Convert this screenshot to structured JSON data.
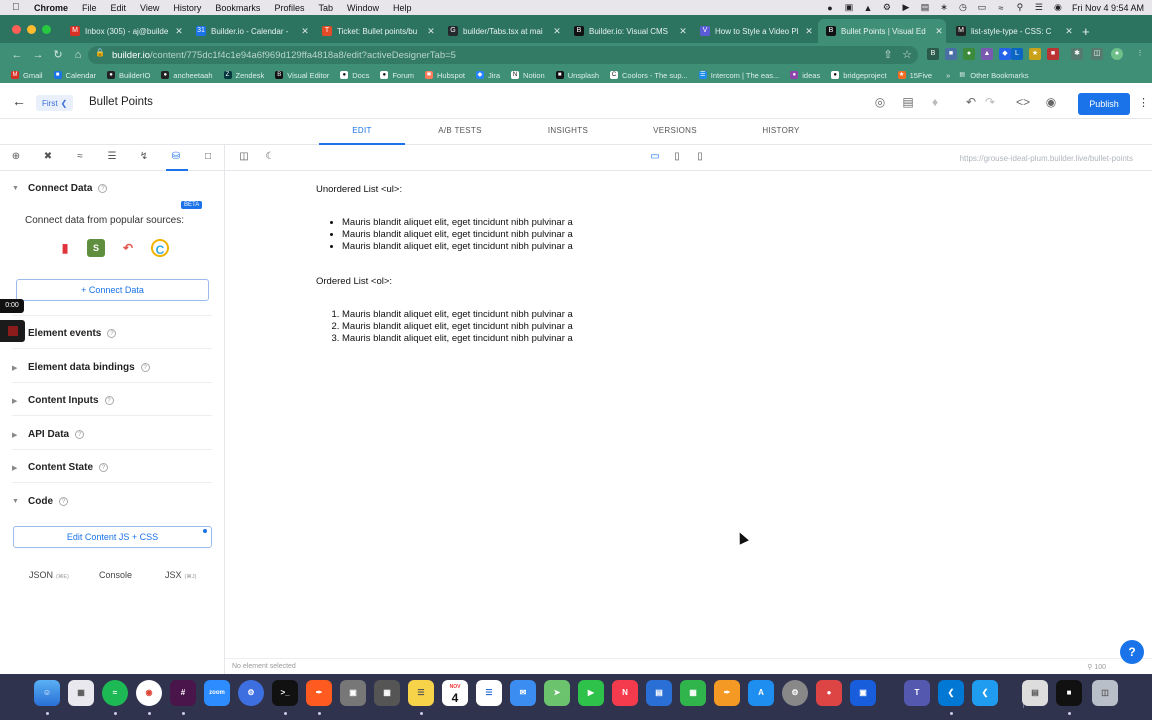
{
  "menubar": {
    "app": "Chrome",
    "items": [
      "File",
      "Edit",
      "View",
      "History",
      "Bookmarks",
      "Profiles",
      "Tab",
      "Window",
      "Help"
    ],
    "clock": "Fri Nov 4  9:54 AM"
  },
  "browser": {
    "tabs": [
      {
        "title": "Inbox (305) - aj@builde",
        "color": "#d93025",
        "glyph": "M"
      },
      {
        "title": "Builder.io - Calendar -",
        "color": "#1a73e8",
        "glyph": "31"
      },
      {
        "title": "Ticket: Bullet points/bu",
        "color": "#e34c26",
        "glyph": "T"
      },
      {
        "title": "builder/Tabs.tsx at mai",
        "color": "#24292e",
        "glyph": "G"
      },
      {
        "title": "Builder.io: Visual CMS",
        "color": "#111111",
        "glyph": "B"
      },
      {
        "title": "How to Style a Video Pl",
        "color": "#5b5bd6",
        "glyph": "V"
      },
      {
        "title": "Bullet Points | Visual Ed",
        "color": "#111111",
        "glyph": "B"
      },
      {
        "title": "list-style-type - CSS: C",
        "color": "#222222",
        "glyph": "M"
      }
    ],
    "url_host": "builder.io",
    "url_path": "/content/775dc1f4c1e94a6f969d129ffa4818a8/edit?activeDesignerTab=5",
    "bookmarks": [
      "Gmail",
      "Calendar",
      "BuilderIO",
      "ancheetaah",
      "Zendesk",
      "Visual Editor",
      "Docs",
      "Forum",
      "Hubspot",
      "Jira",
      "Notion",
      "Unsplash",
      "Coolors - The sup...",
      "Intercom | The eas...",
      "ideas",
      "bridgeproject",
      "15Five"
    ],
    "other_bookmarks": "Other Bookmarks"
  },
  "editor": {
    "back_icon": "back-arrow-icon",
    "pill_label": "First",
    "title": "Bullet Points",
    "publish_label": "Publish",
    "tabs": [
      "EDIT",
      "A/B TESTS",
      "INSIGHTS",
      "VERSIONS",
      "HISTORY"
    ],
    "active_tab": "EDIT",
    "preview_url": "https://grouse-ideal-plum.builder.live/bullet-points",
    "status_left": "No element selected",
    "zoom": "100",
    "help_glyph": "?"
  },
  "panel": {
    "connect_title": "Connect Data",
    "beta": "BETA",
    "connect_sub": "Connect data from popular sources:",
    "connect_button": "+ Connect Data",
    "sections": [
      "Element events",
      "Element data bindings",
      "Content Inputs",
      "API Data",
      "Content State"
    ],
    "code_title": "Code",
    "edit_js_button": "Edit Content JS + CSS",
    "code_tabs": [
      {
        "label": "JSON",
        "kbd": "(⌘E)"
      },
      {
        "label": "Console",
        "kbd": ""
      },
      {
        "label": "JSX",
        "kbd": "(⌘J)"
      }
    ],
    "timer": "0:00"
  },
  "content": {
    "ul_heading": "Unordered List <ul>:",
    "ul_items": [
      "Mauris blandit aliquet elit, eget tincidunt nibh pulvinar a",
      "Mauris blandit aliquet elit, eget tincidunt nibh pulvinar a",
      "Mauris blandit aliquet elit, eget tincidunt nibh pulvinar a"
    ],
    "ol_heading": "Ordered List <ol>:",
    "ol_items": [
      "Mauris blandit aliquet elit, eget tincidunt nibh pulvinar a",
      "Mauris blandit aliquet elit, eget tincidunt nibh pulvinar a",
      "Mauris blandit aliquet elit, eget tincidunt nibh pulvinar a"
    ]
  },
  "dock": {
    "apps": [
      "finder",
      "launchpad",
      "spotify",
      "chrome",
      "slack",
      "zoom",
      "settings-gear",
      "terminal",
      "pen-tool",
      "screenshot",
      "calculator",
      "notes",
      "calendar",
      "reminders",
      "mail",
      "maps",
      "facetime",
      "news",
      "keynote",
      "numbers",
      "pages",
      "app-store",
      "system-preferences",
      "screen-recorder",
      "bitwarden",
      "teams",
      "vscode",
      "vscode-insiders",
      "preview",
      "terminal-window",
      "trash"
    ],
    "calendar_month": "NOV",
    "calendar_day": "4"
  },
  "colors": {
    "accent": "#1a73e8",
    "chrome_green": "#3f8f77",
    "dock": "#30334d"
  }
}
